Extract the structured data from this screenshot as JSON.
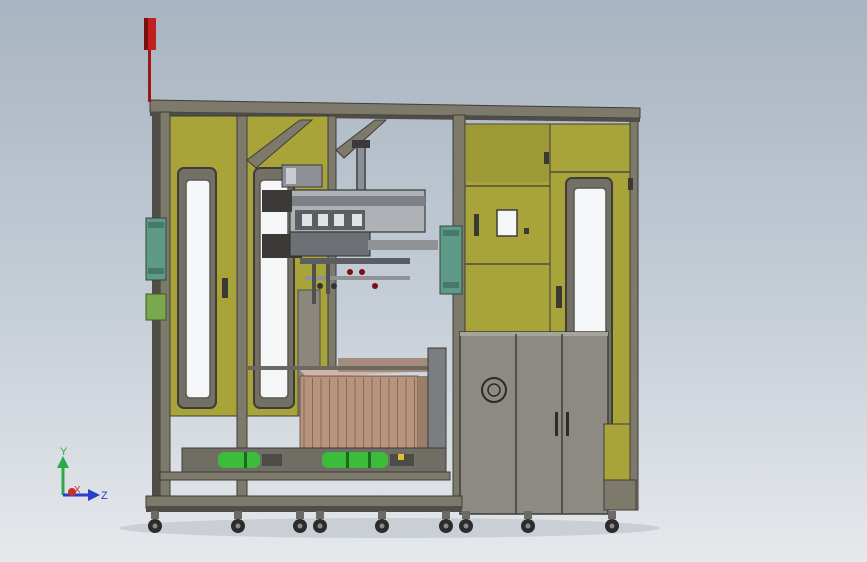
{
  "triad": {
    "y_label": "Y",
    "x_label": "X",
    "z_label": "Z",
    "y_color": "#2ea84a",
    "x_color": "#c8302a",
    "z_color": "#2a3fc8"
  },
  "colors": {
    "frame": "#7d7a6c",
    "frame_dark": "#4f4d45",
    "panel": "#a8a43a",
    "panel_dark": "#8a8630",
    "cabinet": "#8c8a82",
    "cabinet_dark": "#5e5c56",
    "motor": "#3bbd3b",
    "mount_block": "#5f9a86",
    "mount_block_alt": "#7aa84c",
    "beacon": "#c02020",
    "stack": "#b8947e",
    "caster": "#2c2c2c"
  }
}
